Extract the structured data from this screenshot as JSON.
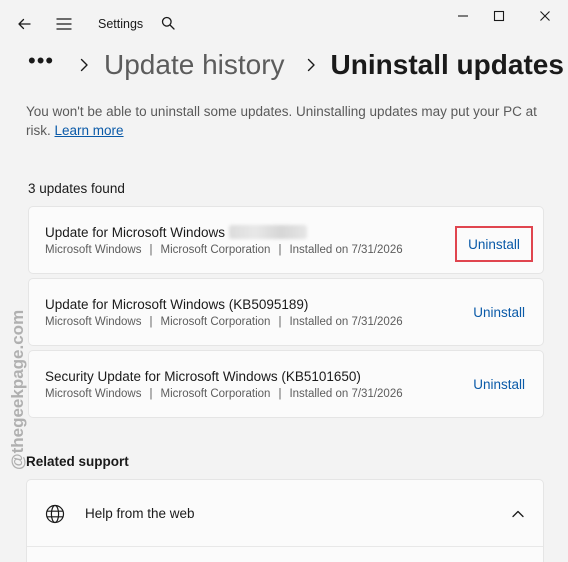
{
  "titlebar": {
    "app_title": "Settings",
    "icons": [
      "back-arrow-icon",
      "hamburger-menu-icon",
      "search-icon",
      "minimize-icon",
      "maximize-icon",
      "close-icon"
    ]
  },
  "breadcrumb": {
    "more": "•••",
    "parent": "Update history",
    "current": "Uninstall updates"
  },
  "warning": {
    "text": "You won't be able to uninstall some updates. Uninstalling updates may put your PC at risk.",
    "link": "Learn more"
  },
  "updates_found": "3 updates found",
  "updates": [
    {
      "title": "Update for Microsoft Windows",
      "kb_redacted": true,
      "category": "Microsoft Windows",
      "publisher": "Microsoft Corporation",
      "installed": "Installed on 7/31/2026",
      "action": "Uninstall",
      "highlighted": true
    },
    {
      "title": "Update for Microsoft Windows (KB5095189)",
      "category": "Microsoft Windows",
      "publisher": "Microsoft Corporation",
      "installed": "Installed on 7/31/2026",
      "action": "Uninstall"
    },
    {
      "title": "Security Update for Microsoft Windows (KB5101650)",
      "category": "Microsoft Windows",
      "publisher": "Microsoft Corporation",
      "installed": "Installed on 7/31/2026",
      "action": "Uninstall"
    }
  ],
  "related": {
    "heading": "Related support",
    "help_label": "Help from the web"
  },
  "watermark": "@thegeekpage.com",
  "colors": {
    "accent": "#0a5aa8",
    "highlight_box": "#e0454f",
    "background": "#f3f3f3"
  }
}
